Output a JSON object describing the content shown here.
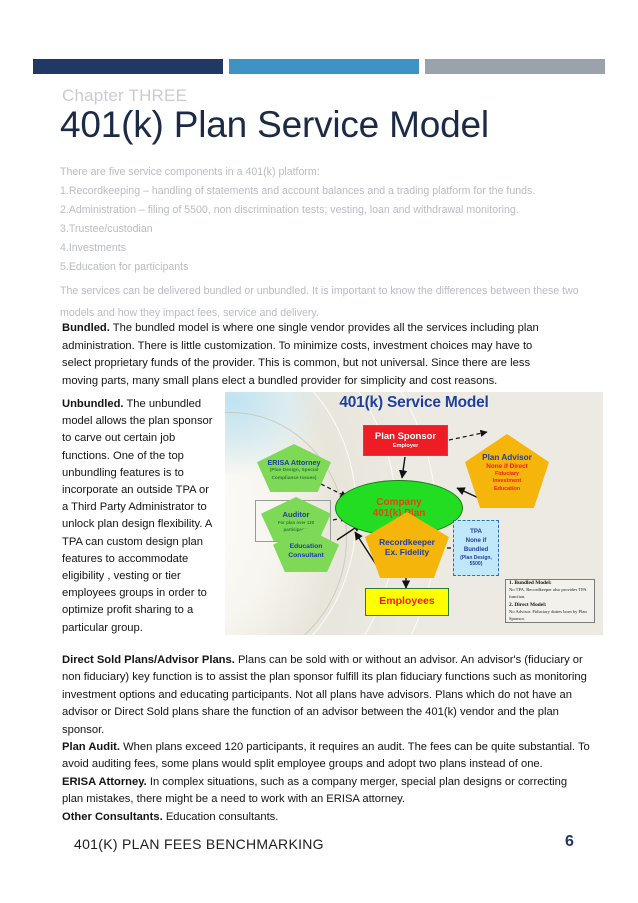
{
  "banner": {
    "segments": [
      {
        "name": "navy",
        "color": "#1f3864"
      },
      {
        "name": "blue",
        "color": "#3e93c4"
      },
      {
        "name": "gray",
        "color": "#9aa2ab"
      }
    ]
  },
  "header": {
    "chapter_label": "Chapter THREE",
    "title": "401(k) Plan Service Model"
  },
  "intro": {
    "lead": "There are five service components in a 401(k) platform:",
    "items": [
      "1.Recordkeeping – handling of statements and account balances and a trading platform for the funds.",
      "2.Administration – filing of 5500, non discrimination tests; vesting, loan and withdrawal monitoring.",
      "3.Trustee/custodian",
      "4.Investments",
      "5.Education for participants"
    ],
    "tail": "The services can be delivered bundled or unbundled.  It is important to know the differences between these two models and how they impact fees, service and delivery."
  },
  "bundled": {
    "heading": "Bundled.",
    "body": "The bundled model is where one single vendor provides all the services including plan administration.  There is little customization.  To minimize costs, investment choices may have to select proprietary funds of the provider.  This is common, but not universal. Since there are  less moving parts, many small plans elect a bundled provider for simplicity and cost reasons."
  },
  "unbundled": {
    "heading": "Unbundled.",
    "body": "The unbundled model allows the plan sponsor to carve out certain job functions. One of the top unbundling features is to incorporate an outside TPA or a Third Party Administrator to unlock plan design flexibility.  A TPA can custom design plan features to accommodate eligibility , vesting or tier employees groups in order to optimize profit sharing to a particular group."
  },
  "bottom": [
    {
      "heading": "Direct Sold Plans/Advisor Plans.",
      "body": "Plans can be sold with or without an advisor.  An advisor's (fiduciary or non fiduciary) key function is to assist the plan sponsor fulfill its plan fiduciary functions such as monitoring investment options and educating participants.  Not all plans have advisors.  Plans which do not have an advisor or Direct Sold plans share the function of an advisor between the 401(k) vendor and the plan sponsor."
    },
    {
      "heading": "Plan Audit.",
      "body": "When plans exceed 120 participants, it requires an audit.  The fees can be quite substantial.  To avoid auditing fees, some plans would split employee groups and adopt two plans instead of one."
    },
    {
      "heading": "ERISA Attorney.",
      "body": "In complex situations, such as a company merger, special plan designs or correcting plan mistakes, there might be a need to work with an ERISA attorney."
    },
    {
      "heading": "Other Consultants.",
      "body": "Education consultants."
    }
  ],
  "footer": {
    "title": "401(K) PLAN FEES BENCHMARKING",
    "page_number": "6"
  },
  "diagram": {
    "title": "401(k) Service Model",
    "nodes": {
      "plan_sponsor": {
        "title": "Plan Sponsor",
        "subtitle": "Employer",
        "color": "#ee1c25"
      },
      "plan_advisor": {
        "title": "Plan Advisor",
        "line2": "None if Direct",
        "line3": "Fiduciary",
        "line4": "Investment",
        "line5": "Education",
        "color": "#f5b50a"
      },
      "erisa_attorney": {
        "title": "ERISA Attorney",
        "line2": "(Plan Design, Special",
        "line3": "Compliance Issues)",
        "color": "#7ed957"
      },
      "auditor": {
        "title": "Auditor",
        "line2": "For plan over 120",
        "line3": "participants",
        "color": "#7ed957"
      },
      "education_consultant": {
        "line1": "Education",
        "line2": "Consultant",
        "color": "#7ed957"
      },
      "company_plan": {
        "line1": "Company",
        "line2": "401(k) Plan",
        "color": "#22dd22"
      },
      "recordkeeper": {
        "line1": "Recordkeeper",
        "line2": "Ex. Fidelity",
        "color": "#f5b50a"
      },
      "tpa": {
        "line1": "TPA",
        "line2": "None if",
        "line3": "Bundled",
        "line4": "(Plan Design,",
        "line5": "5500)",
        "color": "#bfe9fb"
      },
      "employees": {
        "title": "Employees",
        "color": "#ffff00"
      }
    },
    "legend": [
      {
        "num": "1.",
        "title": "Bundled Model:",
        "desc": "No TPA. Recordkeeper also provides TPA function."
      },
      {
        "num": "2.",
        "title": "Direct Model:",
        "desc": "No Advisor.  Fiduciary duties born by Plan Sponsor."
      }
    ]
  }
}
